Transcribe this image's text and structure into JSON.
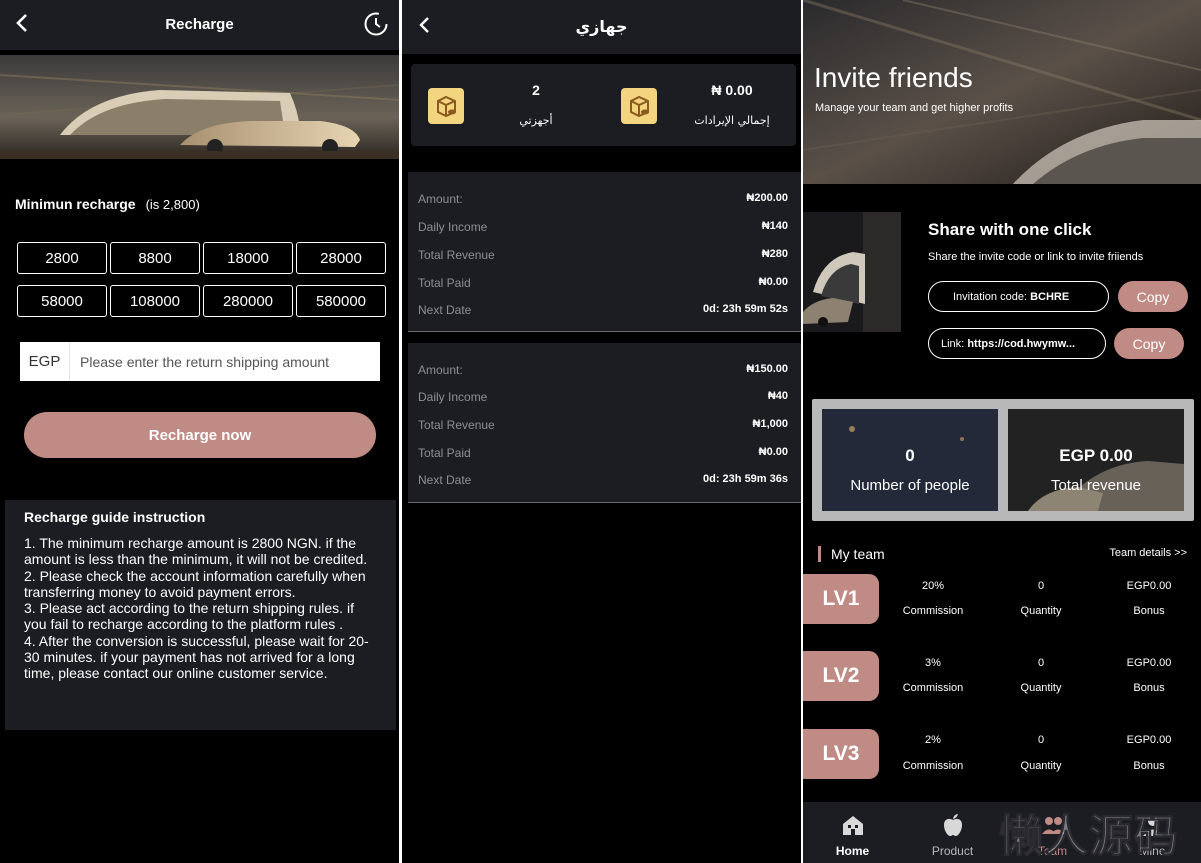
{
  "recharge": {
    "title": "Recharge",
    "min_label": "Minimun recharge",
    "min_note": "(is 2,800)",
    "amounts": [
      "2800",
      "8800",
      "18000",
      "28000",
      "58000",
      "108000",
      "280000",
      "580000"
    ],
    "currency": "EGP",
    "input_placeholder": "Please enter the return shipping amount",
    "button_label": "Recharge now",
    "guide_title": "Recharge guide instruction",
    "guide_items": [
      "1. The minimum recharge amount is 2800 NGN. if the amount is less than the minimum, it will not be credited.",
      "2. Please check the account information carefully when transferring money to avoid payment errors.",
      "3. Please act according to the return shipping rules. if you fail to recharge according to the platform rules .",
      "4. After the conversion is successful, please wait for 20-30 minutes. if your payment has not arrived for a long time, please contact our online customer service."
    ]
  },
  "devices": {
    "title": "جهازي",
    "summary": [
      {
        "value": "2",
        "label": "أجهزتي"
      },
      {
        "value": "₦ 0.00",
        "label": "إجمالي الإيرادات"
      }
    ],
    "cards": [
      {
        "rows": [
          {
            "label": "Amount:",
            "value": "₦200.00"
          },
          {
            "label": "Daily Income",
            "value": "₦140"
          },
          {
            "label": "Total Revenue",
            "value": "₦280"
          },
          {
            "label": "Total Paid",
            "value": "₦0.00"
          },
          {
            "label": "Next Date",
            "value": "0d: 23h 59m 52s"
          }
        ]
      },
      {
        "rows": [
          {
            "label": "Amount:",
            "value": "₦150.00"
          },
          {
            "label": "Daily Income",
            "value": "₦40"
          },
          {
            "label": "Total Revenue",
            "value": "₦1,000"
          },
          {
            "label": "Total Paid",
            "value": "₦0.00"
          },
          {
            "label": "Next Date",
            "value": "0d: 23h 59m 36s"
          }
        ]
      }
    ]
  },
  "invite": {
    "title": "Invite friends",
    "subtitle": "Manage your team and get higher profits",
    "share_title": "Share with one click",
    "share_sub": "Share the invite code or link to invite friiends",
    "code_prefix": "Invitation code:",
    "code": "BCHRE",
    "link_prefix": "Link:",
    "link": "https://cod.hwymw...",
    "copy_label": "Copy",
    "stats": [
      {
        "value": "0",
        "label": "Number of people"
      },
      {
        "value": "EGP 0.00",
        "label": "Total revenue"
      }
    ],
    "team_label": "My team",
    "team_details": "Team details >>",
    "levels": [
      {
        "name": "LV1",
        "commission": "20%",
        "quantity": "0",
        "bonus": "EGP0.00"
      },
      {
        "name": "LV2",
        "commission": "3%",
        "quantity": "0",
        "bonus": "EGP0.00"
      },
      {
        "name": "LV3",
        "commission": "2%",
        "quantity": "0",
        "bonus": "EGP0.00"
      }
    ],
    "col_labels": {
      "commission": "Commission",
      "quantity": "Quantity",
      "bonus": "Bonus"
    },
    "nav": [
      {
        "label": "Home",
        "icon": "home-icon"
      },
      {
        "label": "Product",
        "icon": "apple-icon"
      },
      {
        "label": "Team",
        "icon": "team-icon"
      },
      {
        "label": "Mine",
        "icon": "user-icon"
      }
    ],
    "watermark": "懒人源码"
  },
  "colors": {
    "accent": "#c08a85",
    "card": "#1c1d22",
    "gold": "#f3d47f"
  }
}
